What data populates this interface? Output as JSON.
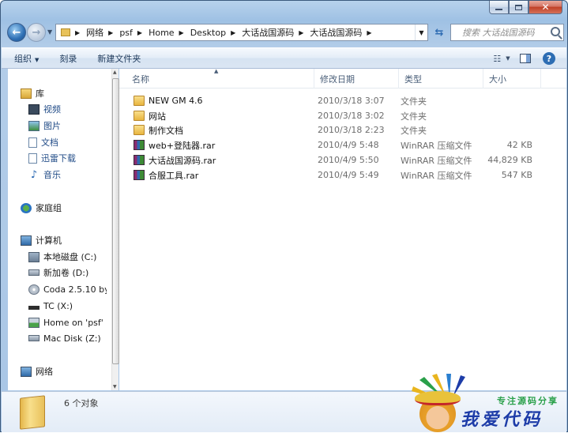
{
  "address": {
    "crumbs": [
      "网络",
      "psf",
      "Home",
      "Desktop",
      "大话战国源码",
      "大话战国源码"
    ],
    "search_placeholder": "搜索 大话战国源码"
  },
  "toolbar": {
    "organize": "组织",
    "share": "刻录",
    "new_folder": "新建文件夹"
  },
  "nav": {
    "library": "库",
    "videos": "视频",
    "pictures": "图片",
    "documents": "文档",
    "xunlei": "迅雷下载",
    "music": "音乐",
    "homegroup": "家庭组",
    "computer": "计算机",
    "drives": [
      "本地磁盘 (C:)",
      "新加卷 (D:)",
      "Coda 2.5.10 by",
      "TC (X:)",
      "Home on 'psf' (",
      "Mac Disk (Z:)"
    ],
    "network": "网络"
  },
  "columns": {
    "name": "名称",
    "date": "修改日期",
    "type": "类型",
    "size": "大小"
  },
  "files": [
    {
      "name": "NEW GM 4.6",
      "date": "2010/3/18 3:07",
      "type": "文件夹",
      "size": "",
      "icon": "folder-icon"
    },
    {
      "name": "网站",
      "date": "2010/3/18 3:02",
      "type": "文件夹",
      "size": "",
      "icon": "folder-icon"
    },
    {
      "name": "制作文档",
      "date": "2010/3/18 2:23",
      "type": "文件夹",
      "size": "",
      "icon": "folder-icon"
    },
    {
      "name": "web+登陆器.rar",
      "date": "2010/4/9 5:48",
      "type": "WinRAR 压缩文件",
      "size": "42 KB",
      "icon": "rar-icon"
    },
    {
      "name": "大话战国源码.rar",
      "date": "2010/4/9 5:50",
      "type": "WinRAR 压缩文件",
      "size": "44,829 KB",
      "icon": "rar-icon"
    },
    {
      "name": "合服工具.rar",
      "date": "2010/4/9 5:49",
      "type": "WinRAR 压缩文件",
      "size": "547 KB",
      "icon": "rar-icon"
    }
  ],
  "details": {
    "count": "6 个对象"
  },
  "watermark": {
    "tagline": "专注源码分享",
    "title": "我爱代码"
  }
}
